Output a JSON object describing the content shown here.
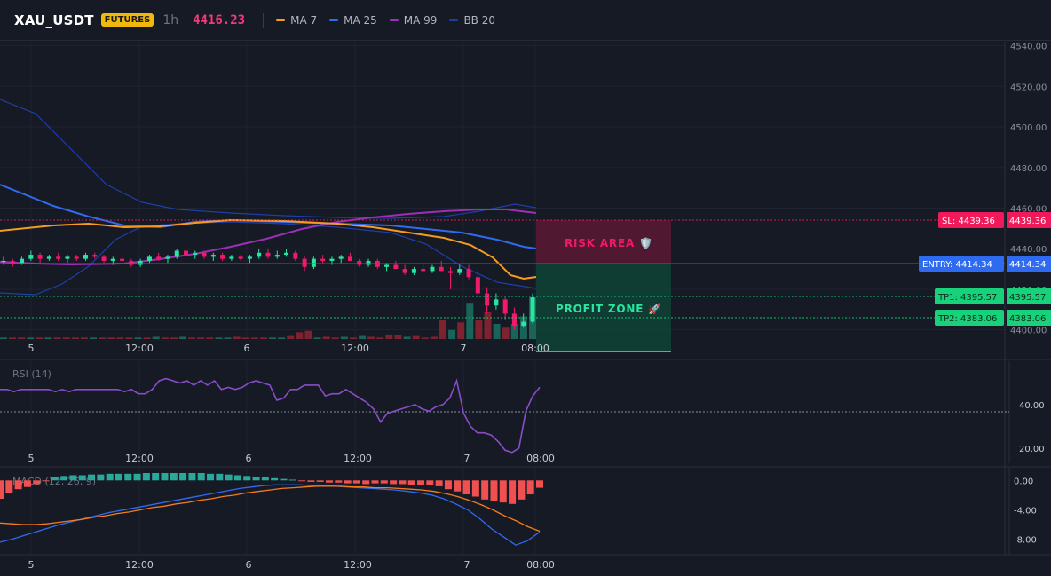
{
  "header": {
    "symbol": "XAU_USDT",
    "badge": "FUTURES",
    "timeframe": "1h",
    "price": "4416.23",
    "legend": [
      {
        "label": "MA 7",
        "color": "#f59b1e"
      },
      {
        "label": "MA 25",
        "color": "#2f6bf0"
      },
      {
        "label": "MA 99",
        "color": "#9c2fb8"
      },
      {
        "label": "BB 20",
        "color": "#1f3fa8"
      }
    ]
  },
  "colors": {
    "bg": "#161a25",
    "grid": "#1f2330",
    "up": "#26e6a0",
    "down": "#f0196a",
    "vol_up": "#1b6b5e",
    "vol_down": "#8a2432",
    "risk": "#5a1a34",
    "profit": "#0f4a38",
    "sl": "#f0195a",
    "entry": "#2f6bf0",
    "tp": "#17d27a",
    "rsi": "#8a4cc8",
    "macd": "#2f6bf0",
    "signal": "#f57c1e",
    "hist_pos": "#2aa89a",
    "hist_neg": "#f0504f"
  },
  "chart_data": [
    {
      "type": "candlestick",
      "title": "XAU_USDT 1h",
      "x_ticks": [
        "5",
        "12:00",
        "6",
        "12:00",
        "7",
        "08:00"
      ],
      "y_ticks": [
        "4540.00",
        "4520.00",
        "4500.00",
        "4480.00",
        "4460.00",
        "4440.00",
        "4420.00",
        "4400.00"
      ],
      "ylim": [
        4396,
        4542
      ],
      "ohlc": [
        [
          4434,
          4436,
          4432,
          4434
        ],
        [
          4434,
          4435,
          4431,
          4433
        ],
        [
          4433,
          4436,
          4432,
          4435
        ],
        [
          4435,
          4439,
          4434,
          4437
        ],
        [
          4437,
          4438,
          4433,
          4435
        ],
        [
          4435,
          4437,
          4434,
          4436
        ],
        [
          4436,
          4438,
          4434,
          4435
        ],
        [
          4435,
          4437,
          4433,
          4436
        ],
        [
          4436,
          4437,
          4434,
          4435
        ],
        [
          4435,
          4438,
          4434,
          4437
        ],
        [
          4437,
          4438,
          4435,
          4436
        ],
        [
          4436,
          4437,
          4433,
          4434
        ],
        [
          4434,
          4436,
          4432,
          4435
        ],
        [
          4435,
          4436,
          4433,
          4434
        ],
        [
          4434,
          4435,
          4431,
          4432
        ],
        [
          4432,
          4435,
          4431,
          4434
        ],
        [
          4434,
          4437,
          4433,
          4436
        ],
        [
          4436,
          4438,
          4434,
          4435
        ],
        [
          4435,
          4437,
          4433,
          4436
        ],
        [
          4436,
          4440,
          4435,
          4439
        ],
        [
          4439,
          4440,
          4436,
          4437
        ],
        [
          4437,
          4439,
          4435,
          4438
        ],
        [
          4438,
          4439,
          4435,
          4436
        ],
        [
          4436,
          4438,
          4434,
          4437
        ],
        [
          4437,
          4438,
          4434,
          4435
        ],
        [
          4435,
          4437,
          4434,
          4436
        ],
        [
          4436,
          4437,
          4434,
          4435
        ],
        [
          4435,
          4437,
          4433,
          4436
        ],
        [
          4436,
          4440,
          4435,
          4438
        ],
        [
          4438,
          4440,
          4435,
          4436
        ],
        [
          4436,
          4439,
          4435,
          4437
        ],
        [
          4437,
          4440,
          4436,
          4438
        ],
        [
          4438,
          4439,
          4434,
          4435
        ],
        [
          4435,
          4436,
          4429,
          4431
        ],
        [
          4431,
          4436,
          4430,
          4435
        ],
        [
          4435,
          4437,
          4433,
          4434
        ],
        [
          4434,
          4436,
          4432,
          4435
        ],
        [
          4435,
          4437,
          4433,
          4436
        ],
        [
          4436,
          4438,
          4434,
          4434
        ],
        [
          4434,
          4435,
          4431,
          4432
        ],
        [
          4432,
          4435,
          4431,
          4434
        ],
        [
          4434,
          4435,
          4430,
          4431
        ],
        [
          4431,
          4433,
          4429,
          4432
        ],
        [
          4432,
          4434,
          4430,
          4430
        ],
        [
          4430,
          4432,
          4427,
          4428
        ],
        [
          4428,
          4431,
          4427,
          4430
        ],
        [
          4430,
          4432,
          4428,
          4429
        ],
        [
          4429,
          4432,
          4428,
          4431
        ],
        [
          4431,
          4434,
          4429,
          4429
        ],
        [
          4429,
          4431,
          4420,
          4428
        ],
        [
          4428,
          4432,
          4427,
          4430
        ],
        [
          4430,
          4432,
          4425,
          4426
        ],
        [
          4426,
          4428,
          4416,
          4418
        ],
        [
          4418,
          4421,
          4408,
          4412
        ],
        [
          4412,
          4418,
          4410,
          4415
        ],
        [
          4415,
          4416,
          4405,
          4408
        ],
        [
          4408,
          4411,
          4400,
          4402
        ],
        [
          4402,
          4408,
          4401,
          4404
        ],
        [
          4404,
          4418,
          4403,
          4416
        ]
      ],
      "volume": [
        2,
        2,
        2,
        2,
        2,
        2,
        2,
        2,
        2,
        2,
        2,
        2,
        2,
        2,
        2,
        2,
        2,
        3,
        2,
        2,
        3,
        2,
        2,
        2,
        2,
        2,
        3,
        2,
        2,
        2,
        2,
        2,
        4,
        9,
        11,
        2,
        3,
        2,
        3,
        2,
        4,
        3,
        2,
        6,
        5,
        3,
        4,
        2,
        3,
        25,
        12,
        22,
        48,
        25,
        36,
        20,
        15,
        20,
        30,
        55
      ]
    },
    {
      "type": "line",
      "title": "RSI (14)",
      "y_ticks": [
        "40.00",
        "20.00"
      ],
      "x_ticks": [
        "5",
        "12:00",
        "6",
        "12:00",
        "7",
        "08:00"
      ],
      "ylim": [
        13,
        60
      ],
      "values": [
        47,
        47,
        46,
        47,
        47,
        47,
        47,
        47,
        46,
        47,
        46,
        47,
        47,
        47,
        47,
        47,
        47,
        47,
        46,
        47,
        45,
        45,
        47,
        51,
        52,
        51,
        50,
        51,
        49,
        51,
        49,
        51,
        47,
        48,
        47,
        48,
        50,
        51,
        50,
        49,
        42,
        43,
        47,
        47,
        49,
        49,
        49,
        44,
        45,
        45,
        47,
        45,
        43,
        41,
        38,
        32,
        36,
        37,
        38,
        39,
        40,
        38,
        37,
        39,
        40,
        43,
        51,
        36,
        30,
        27,
        27,
        26,
        23,
        19,
        18,
        20,
        37,
        44,
        48
      ]
    },
    {
      "type": "bar",
      "title": "MACD (12, 26, 9)",
      "y_ticks": [
        "0.00",
        "-4.00",
        "-8.00"
      ],
      "x_ticks": [
        "5",
        "12:00",
        "6",
        "12:00",
        "7",
        "08:00"
      ],
      "ylim": [
        -10,
        1
      ],
      "histogram": [
        -2.5,
        -1.7,
        -1.2,
        -0.9,
        -0.5,
        -0.1,
        0.4,
        0.6,
        0.7,
        0.7,
        0.8,
        0.8,
        0.9,
        0.9,
        0.9,
        0.9,
        1.0,
        1.0,
        1.0,
        1.0,
        1.0,
        1.0,
        1.0,
        0.9,
        0.9,
        0.8,
        0.7,
        0.6,
        0.5,
        0.4,
        0.3,
        0.2,
        0.1,
        -0.1,
        -0.2,
        -0.2,
        -0.3,
        -0.3,
        -0.4,
        -0.4,
        -0.5,
        -0.4,
        -0.4,
        -0.5,
        -0.5,
        -0.6,
        -0.6,
        -0.6,
        -0.8,
        -1.2,
        -1.5,
        -1.9,
        -2.2,
        -2.6,
        -2.8,
        -3.0,
        -3.2,
        -2.6,
        -1.9,
        -1.0
      ],
      "macd": [
        -8.4,
        -8.0,
        -7.5,
        -7.0,
        -6.5,
        -6.0,
        -5.6,
        -5.2,
        -4.8,
        -4.4,
        -4.1,
        -3.8,
        -3.5,
        -3.2,
        -2.9,
        -2.6,
        -2.3,
        -2.0,
        -1.7,
        -1.4,
        -1.1,
        -0.9,
        -0.7,
        -0.6,
        -0.6,
        -0.6,
        -0.7,
        -0.7,
        -0.8,
        -0.9,
        -1.0,
        -1.1,
        -1.2,
        -1.3,
        -1.5,
        -1.7,
        -2.0,
        -2.5,
        -3.2,
        -4.0,
        -5.2,
        -6.6,
        -7.7,
        -8.8,
        -8.2,
        -7.0
      ],
      "signal": [
        -5.8,
        -5.9,
        -6.0,
        -6.0,
        -5.9,
        -5.7,
        -5.5,
        -5.3,
        -5.0,
        -4.8,
        -4.5,
        -4.3,
        -4.0,
        -3.7,
        -3.5,
        -3.2,
        -3.0,
        -2.7,
        -2.5,
        -2.2,
        -2.0,
        -1.7,
        -1.5,
        -1.3,
        -1.1,
        -1.0,
        -0.9,
        -0.8,
        -0.8,
        -0.8,
        -0.9,
        -0.9,
        -1.0,
        -1.0,
        -1.1,
        -1.2,
        -1.3,
        -1.5,
        -1.8,
        -2.2,
        -2.7,
        -3.3,
        -4.0,
        -4.8,
        -5.5,
        -6.3,
        -6.9
      ]
    }
  ],
  "overlays": {
    "risk_label": "RISK AREA 🛡️",
    "profit_label": "PROFIT ZONE 🚀",
    "tags": [
      {
        "id": "sl",
        "label": "SL: 4439.36",
        "price": "4439.36",
        "level": 4439.36
      },
      {
        "id": "entry",
        "label": "ENTRY: 4414.34",
        "price": "4414.34",
        "level": 4414.34
      },
      {
        "id": "tp1",
        "label": "TP1: 4395.57",
        "price": "4395.57",
        "level": 4395.57
      },
      {
        "id": "tp2",
        "label": "TP2: 4383.06",
        "price": "4383.06",
        "level": 4383.06
      }
    ]
  }
}
